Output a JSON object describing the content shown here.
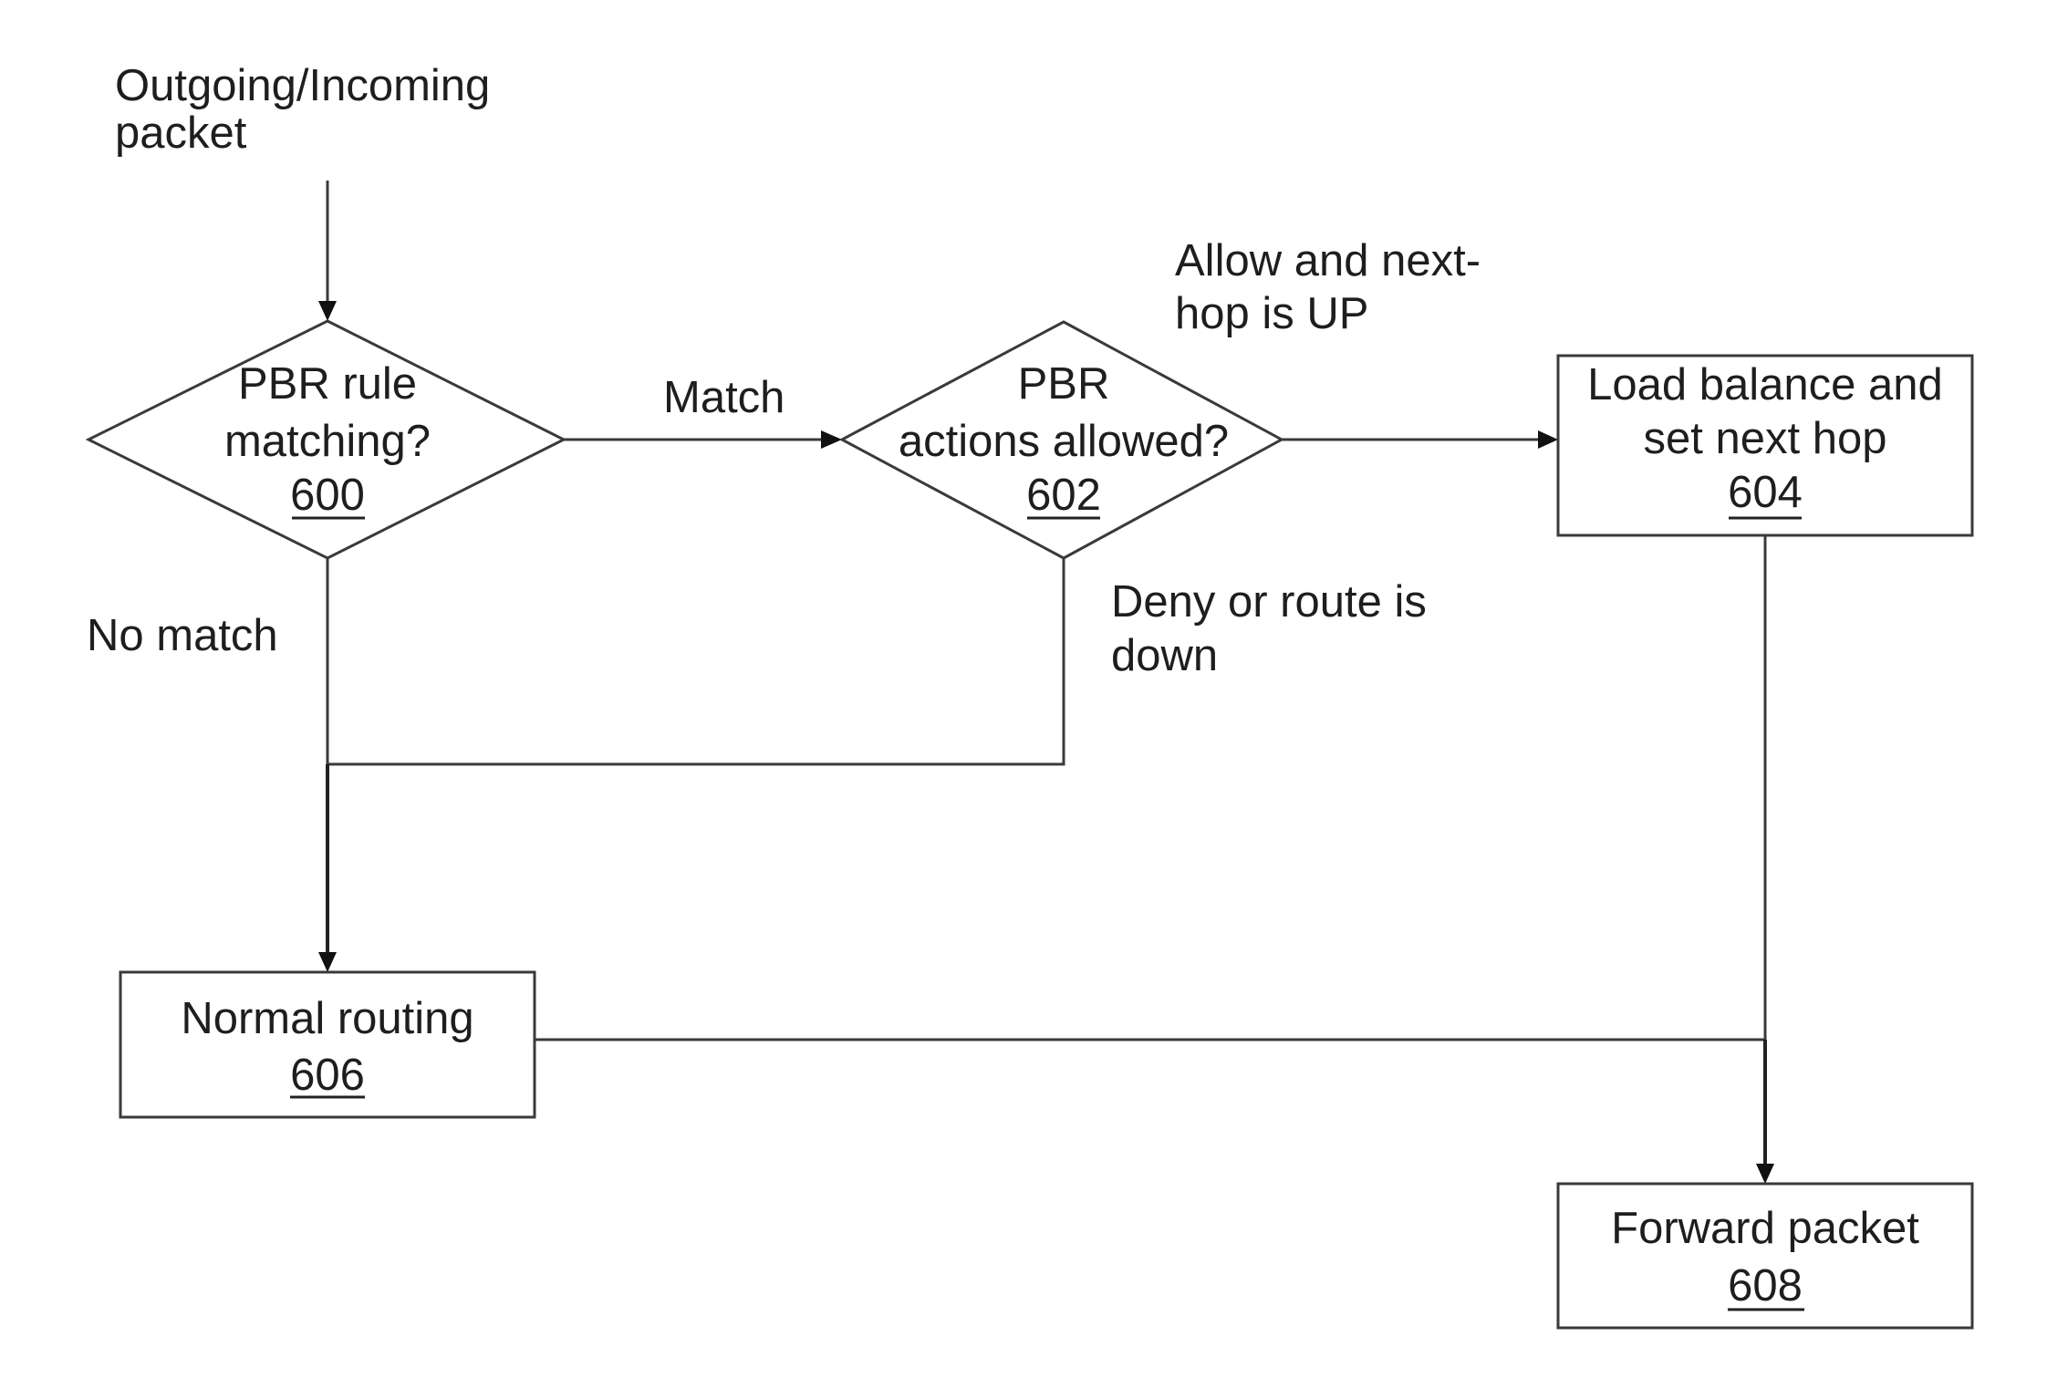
{
  "diagram": {
    "type": "flowchart",
    "start_label": [
      "Outgoing/Incoming",
      "packet"
    ],
    "nodes": {
      "n600": {
        "shape": "decision",
        "lines": [
          "PBR rule",
          "matching?"
        ],
        "ref": "600"
      },
      "n602": {
        "shape": "decision",
        "lines": [
          "PBR",
          "actions allowed?"
        ],
        "ref": "602"
      },
      "n604": {
        "shape": "process",
        "lines": [
          "Load balance and",
          "set next hop"
        ],
        "ref": "604"
      },
      "n606": {
        "shape": "process",
        "lines": [
          "Normal routing"
        ],
        "ref": "606"
      },
      "n608": {
        "shape": "process",
        "lines": [
          "Forward packet"
        ],
        "ref": "608"
      }
    },
    "edge_labels": {
      "match": [
        "Match"
      ],
      "no_match": [
        "No match"
      ],
      "allow": [
        "Allow and next-",
        "hop is UP"
      ],
      "deny": [
        "Deny or route is",
        "down"
      ]
    },
    "edges": [
      {
        "from": "start",
        "to": "600",
        "label": ""
      },
      {
        "from": "600",
        "to": "602",
        "label": "Match"
      },
      {
        "from": "600",
        "to": "606",
        "label": "No match"
      },
      {
        "from": "602",
        "to": "604",
        "label": "Allow and next-hop is UP"
      },
      {
        "from": "602",
        "to": "606",
        "label": "Deny or route is down"
      },
      {
        "from": "604",
        "to": "608",
        "label": ""
      },
      {
        "from": "606",
        "to": "608",
        "label": ""
      }
    ]
  }
}
